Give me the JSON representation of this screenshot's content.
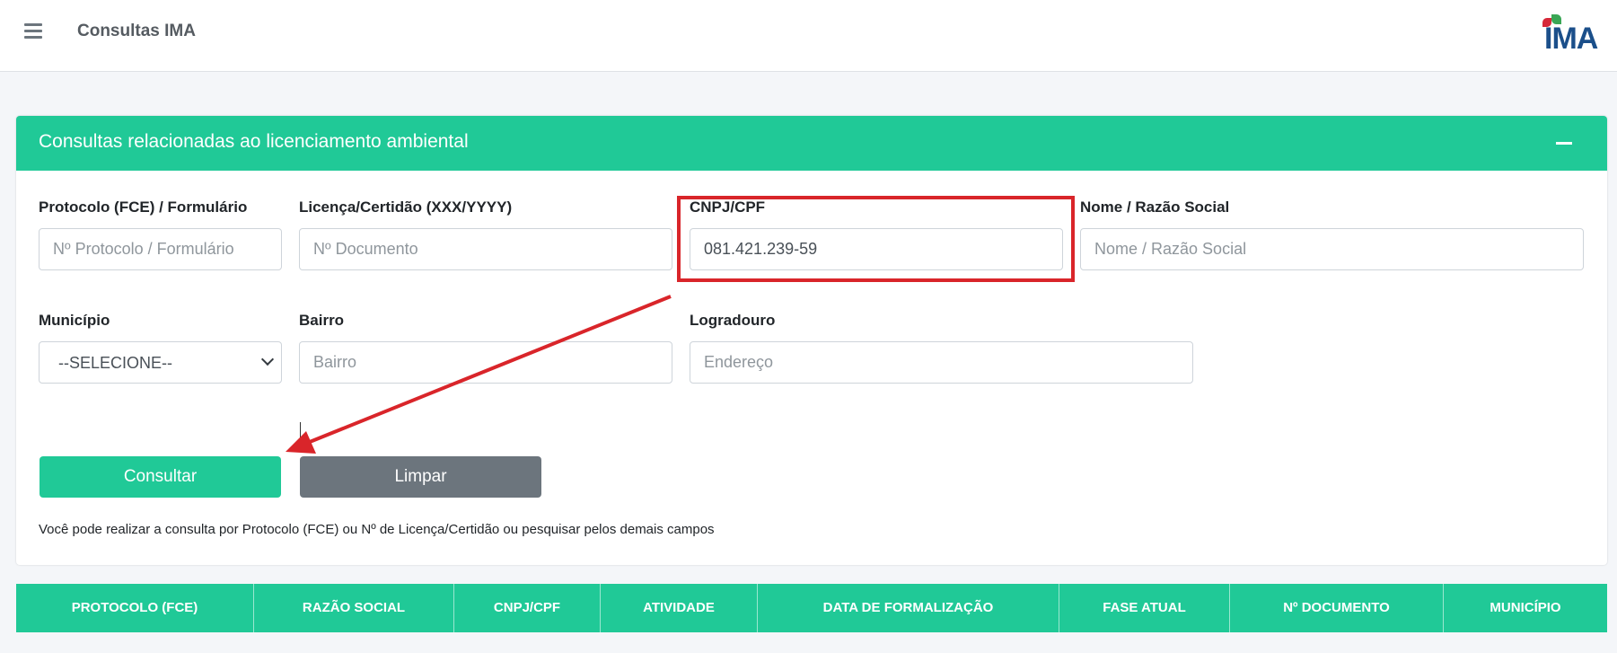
{
  "topbar": {
    "menu_icon": "hamburger-menu-icon",
    "title": "Consultas IMA",
    "logo_text": "IMA"
  },
  "card": {
    "title": "Consultas relacionadas ao licenciamento ambiental",
    "collapse_icon": "minus-icon"
  },
  "form": {
    "protocolo": {
      "label": "Protocolo (FCE) / Formulário",
      "placeholder": "Nº Protocolo / Formulário",
      "value": ""
    },
    "licenca": {
      "label": "Licença/Certidão (XXX/YYYY)",
      "placeholder": "Nº Documento",
      "value": ""
    },
    "cnpj": {
      "label": "CNPJ/CPF",
      "placeholder": "",
      "value": "081.421.239-59"
    },
    "nome": {
      "label": "Nome / Razão Social",
      "placeholder": "Nome / Razão Social",
      "value": ""
    },
    "municipio": {
      "label": "Município",
      "selected": "--SELECIONE--"
    },
    "bairro": {
      "label": "Bairro",
      "placeholder": "Bairro",
      "value": ""
    },
    "logradouro": {
      "label": "Logradouro",
      "placeholder": "Endereço",
      "value": ""
    }
  },
  "buttons": {
    "consultar": "Consultar",
    "limpar": "Limpar"
  },
  "hint": "Você pode realizar a consulta por Protocolo (FCE) ou Nº de Licença/Certidão ou pesquisar pelos demais campos",
  "table": {
    "headers": [
      "PROTOCOLO (FCE)",
      "RAZÃO SOCIAL",
      "CNPJ/CPF",
      "ATIVIDADE",
      "DATA DE FORMALIZAÇÃO",
      "FASE ATUAL",
      "Nº DOCUMENTO",
      "MUNICÍPIO"
    ]
  },
  "colors": {
    "accent": "#20c997",
    "secondary": "#6c757d",
    "annotation": "#d9252a"
  }
}
